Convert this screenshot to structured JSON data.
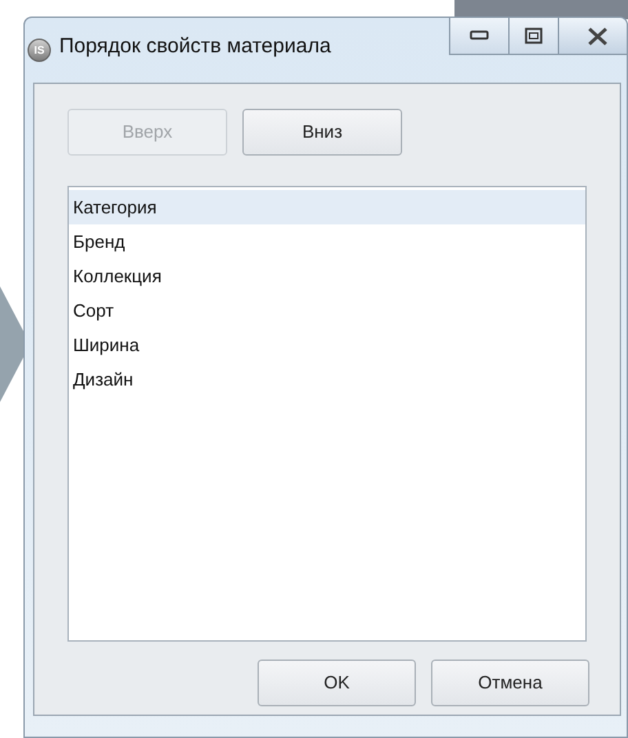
{
  "window": {
    "title": "Порядок свойств материала",
    "icon_text": "IS"
  },
  "move_buttons": [
    {
      "label": "Вверх",
      "disabled": true
    },
    {
      "label": "Вниз",
      "disabled": false
    }
  ],
  "list": [
    {
      "label": "Категория",
      "selected": true
    },
    {
      "label": "Бренд",
      "selected": false
    },
    {
      "label": "Коллекция",
      "selected": false
    },
    {
      "label": "Сорт",
      "selected": false
    },
    {
      "label": "Ширина",
      "selected": false
    },
    {
      "label": "Дизайн",
      "selected": false
    }
  ],
  "dialog_buttons": [
    {
      "label": "OK"
    },
    {
      "label": "Отмена"
    }
  ]
}
